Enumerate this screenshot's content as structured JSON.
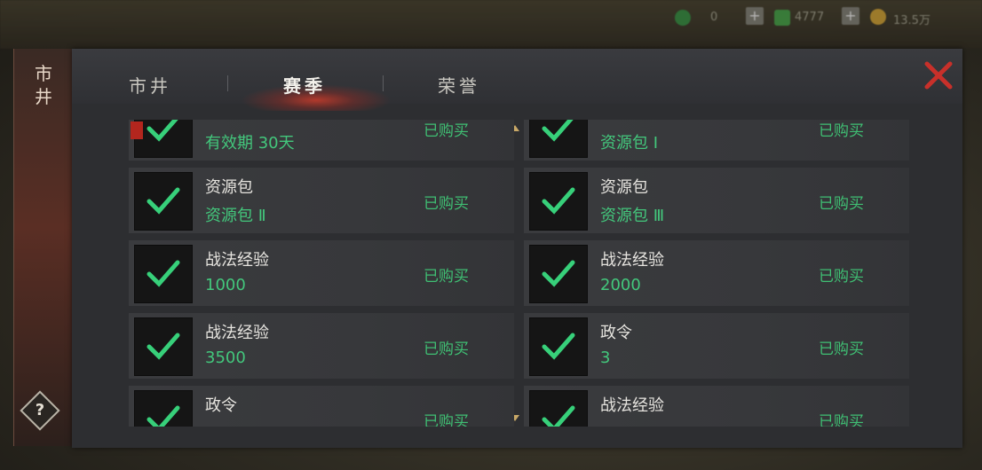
{
  "side": {
    "label_line1": "市",
    "label_line2": "井",
    "help": "?"
  },
  "tabs": [
    {
      "label": "市井",
      "active": false
    },
    {
      "label": "赛季",
      "active": true
    },
    {
      "label": "荣誉",
      "active": false
    }
  ],
  "colors": {
    "accent_green": "#3fbf73",
    "close_red": "#c8302a",
    "glow_red": "#dc3c28"
  },
  "items": [
    {
      "name": "",
      "sub": "有效期 30天",
      "status": "已购买",
      "icon": "check-icon"
    },
    {
      "name": "",
      "sub": "资源包 Ⅰ",
      "status": "已购买",
      "icon": "check-icon"
    },
    {
      "name": "资源包",
      "sub": "资源包 Ⅱ",
      "status": "已购买",
      "icon": "check-icon"
    },
    {
      "name": "资源包",
      "sub": "资源包 Ⅲ",
      "status": "已购买",
      "icon": "check-icon"
    },
    {
      "name": "战法经验",
      "sub": "1000",
      "status": "已购买",
      "icon": "check-icon"
    },
    {
      "name": "战法经验",
      "sub": "2000",
      "status": "已购买",
      "icon": "check-icon"
    },
    {
      "name": "战法经验",
      "sub": "3500",
      "status": "已购买",
      "icon": "check-icon"
    },
    {
      "name": "政令",
      "sub": "3",
      "status": "已购买",
      "icon": "check-icon"
    },
    {
      "name": "政令",
      "sub": "",
      "status": "已购买",
      "icon": "check-icon"
    },
    {
      "name": "战法经验",
      "sub": "",
      "status": "已购买",
      "icon": "check-icon"
    }
  ],
  "hud": {
    "value1": "0",
    "value2": "4777",
    "value3": "13.5万"
  }
}
